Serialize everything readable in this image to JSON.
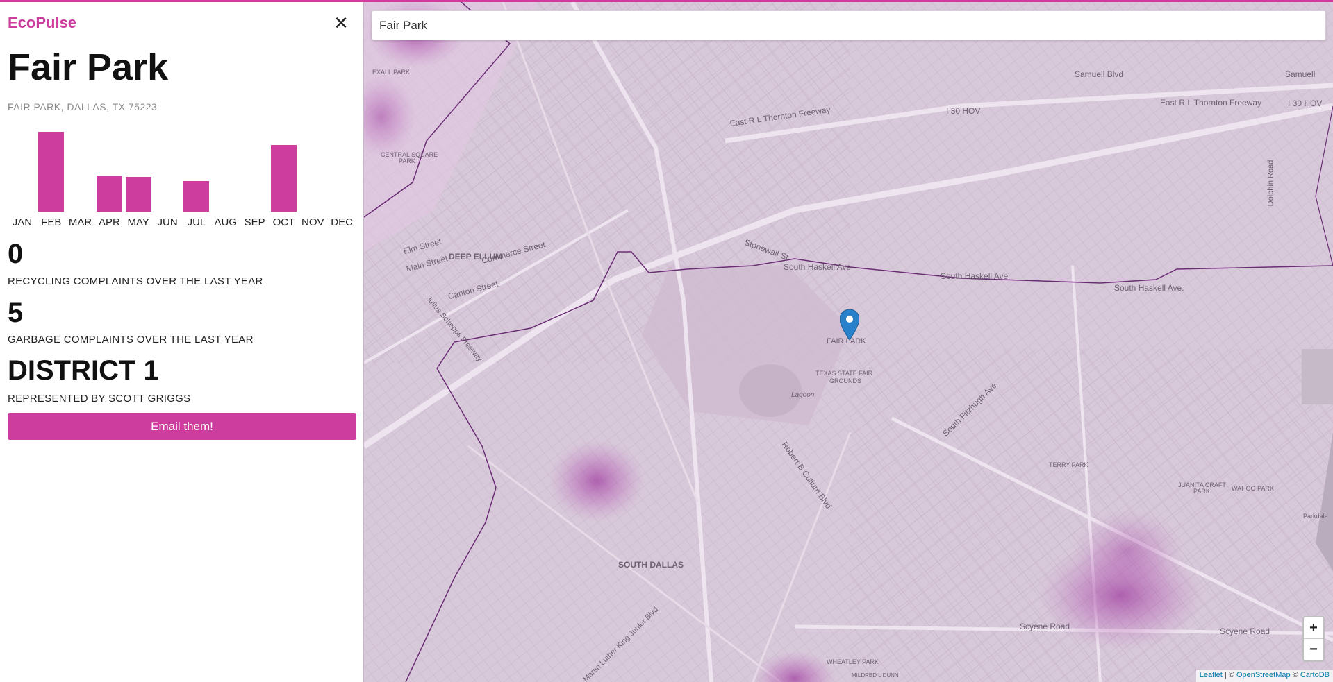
{
  "app": {
    "brand": "EcoPulse",
    "close_label": "✕"
  },
  "location": {
    "title": "Fair Park",
    "address": "FAIR PARK, DALLAS, TX 75223"
  },
  "chart_data": {
    "type": "bar",
    "categories": [
      "JAN",
      "FEB",
      "MAR",
      "APR",
      "MAY",
      "JUN",
      "JUL",
      "AUG",
      "SEP",
      "OCT",
      "NOV",
      "DEC"
    ],
    "values": [
      0,
      6,
      0,
      2.7,
      2.6,
      0,
      2.3,
      0,
      0,
      5,
      0,
      0
    ],
    "title": "",
    "xlabel": "",
    "ylabel": "",
    "ylim": [
      0,
      6
    ],
    "color": "#cc3d9e"
  },
  "stats": {
    "recycling": {
      "count": "0",
      "label": "RECYCLING COMPLAINTS OVER THE LAST YEAR"
    },
    "garbage": {
      "count": "5",
      "label": "GARBAGE COMPLAINTS OVER THE LAST YEAR"
    }
  },
  "district": {
    "name": "DISTRICT 1",
    "representative": "REPRESENTED BY SCOTT GRIGGS",
    "email_label": "Email them!"
  },
  "search": {
    "value": "Fair Park",
    "placeholder": ""
  },
  "map": {
    "labels": {
      "samuell_blvd": "Samuell Blvd",
      "samuell_right": "Samuell",
      "east_rl_thornton": "East R L Thornton Freeway",
      "i30_hov": "I 30 HOV",
      "i30_hov_2": "I 30 HOV",
      "deep_ellum": "DEEP ELLUM",
      "elm_street": "Elm Street",
      "main_street": "Main Street",
      "commerce_street": "Commerce Street",
      "canton_street": "Canton Street",
      "south_haskell": "South Haskell Ave",
      "south_haskell_east": "South Haskell Ave.",
      "stonewall": "Stonewall St",
      "fair_park": "FAIR PARK",
      "texas_state_fair": "TEXAS STATE FAIR",
      "grounds": "GROUNDS",
      "lagoon": "Lagoon",
      "south_fitzhugh": "South Fitzhugh Ave",
      "terry_park": "TERRY PARK",
      "juanita_craft": "JUANITA CRAFT",
      "juanita_craft_park": "PARK",
      "wahoo_park": "WAHOO PARK",
      "south_dallas": "SOUTH DALLAS",
      "scyene_road": "Scyene Road",
      "wheatley_park": "WHEATLEY PARK",
      "central_square": "CENTRAL SQUARE",
      "central_square_park": "PARK",
      "exall_park": "EXALL PARK",
      "parkdale": "Parkdale",
      "dolphin_road": "Dolphin Road",
      "robert_cullum": "Robert B Cullum Blvd",
      "julius_schepps": "Julius Schepps Freeway",
      "martin_luther_king": "Martin Luther King Junior Blvd",
      "mildred_dunn": "MILDRED L DUNN"
    },
    "attribution": {
      "leaflet": "Leaflet",
      "sep": " | © ",
      "osm": "OpenStreetMap",
      "copy": " © ",
      "carto": "CartoDB"
    },
    "zoom_in": "+",
    "zoom_out": "−"
  },
  "colors": {
    "accent": "#cc3d9e",
    "map_bg": "#d8c9da"
  }
}
